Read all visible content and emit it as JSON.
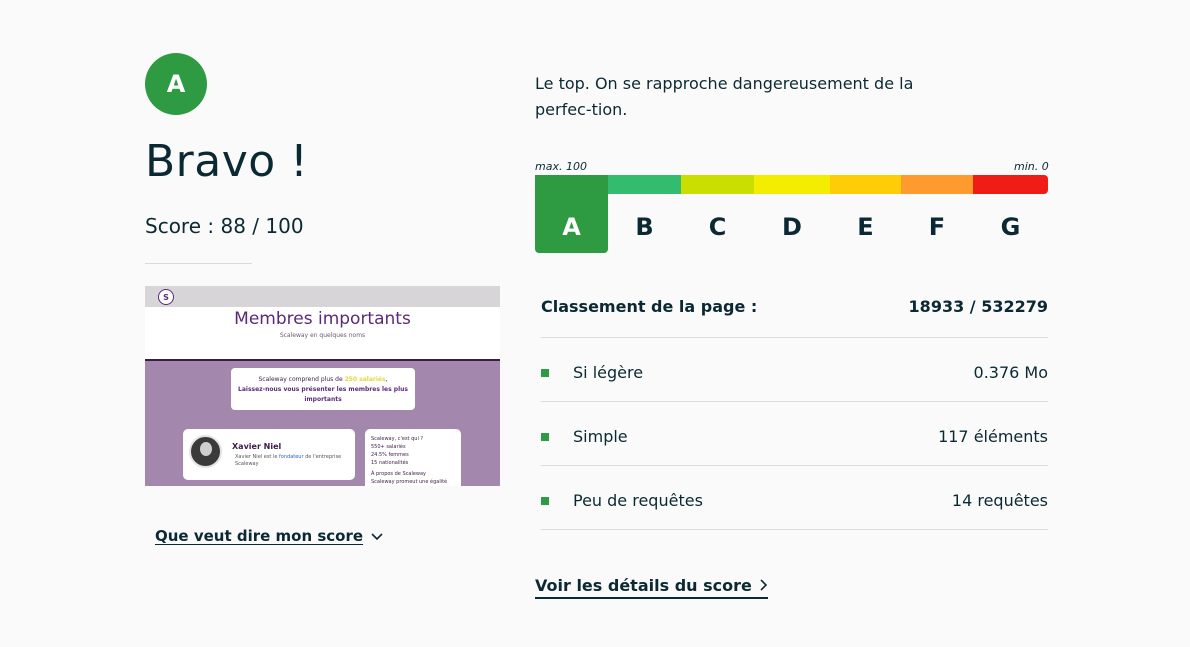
{
  "grade": {
    "letter": "A",
    "color": "#2e9a41"
  },
  "headline": "Bravo !",
  "score_text": "Score : 88 / 100",
  "score_value": 88,
  "preview": {
    "logo": "S",
    "title": "Membres importants",
    "subtitle": "Scaleway en quelques noms",
    "card1_prefix": "Scaleway comprend plus de ",
    "card1_highlight": "250 salariés",
    "card1_suffix": ",",
    "card1_line2": "Laissez-nous vous présenter les membres les plus",
    "card1_line3": "importants",
    "person_name": "Xavier Niel",
    "person_desc_prefix": "Xavier Niel est le ",
    "person_desc_link": "fondateur",
    "person_desc_suffix": " de l'entreprise Scaleway",
    "info_title": "Scaleway, c'est qui ?",
    "info_line1": "550+ salariés",
    "info_line2": "24.5% femmes",
    "info_line3": "15 nationalités",
    "info_line4": "À propos de Scaleway",
    "info_line5": "Scaleway promeut une égalité des"
  },
  "score_help_link": "Que veut dire mon score",
  "description": "Le top. On se rapproche dangereusement de la perfec-tion.",
  "scale": {
    "max_label": "max. 100",
    "min_label": "min. 0",
    "active": "A",
    "grades": [
      {
        "letter": "A",
        "color": "#2e9a41"
      },
      {
        "letter": "B",
        "color": "#34bc6e"
      },
      {
        "letter": "C",
        "color": "#cadf00"
      },
      {
        "letter": "D",
        "color": "#f5ed00"
      },
      {
        "letter": "E",
        "color": "#fecd06"
      },
      {
        "letter": "F",
        "color": "#fe9a2e"
      },
      {
        "letter": "G",
        "color": "#f01c16"
      }
    ]
  },
  "ranking": {
    "label": "Classement de la page :",
    "value": "18933 / 532279"
  },
  "metrics": [
    {
      "label": "Si légère",
      "value": "0.376 Mo"
    },
    {
      "label": "Simple",
      "value": "117 éléments"
    },
    {
      "label": "Peu de requêtes",
      "value": "14 requêtes"
    }
  ],
  "details_link": "Voir les détails du score",
  "icons": {
    "help_chevron": "chevron-down-icon",
    "details_chevron": "chevron-right-icon",
    "bullet": "square-bullet-icon"
  }
}
